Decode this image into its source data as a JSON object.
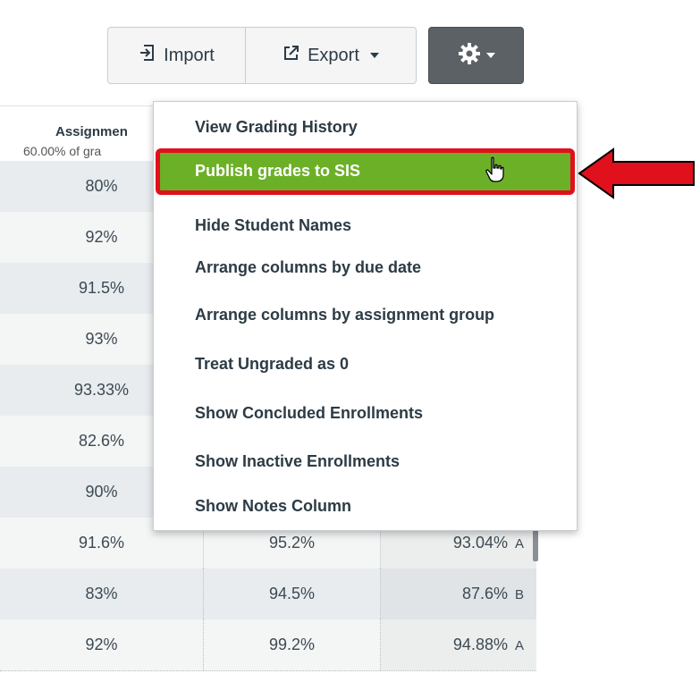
{
  "toolbar": {
    "import_label": "Import",
    "export_label": "Export",
    "icons": {
      "import": "import-icon",
      "export": "export-icon",
      "settings": "gear-icon"
    }
  },
  "grid": {
    "header": {
      "title": "Assignmen",
      "subtitle": "60.00% of gra"
    },
    "rows": [
      {
        "c1": "80%"
      },
      {
        "c1": "92%"
      },
      {
        "c1": "91.5%"
      },
      {
        "c1": "93%"
      },
      {
        "c1": "93.33%"
      },
      {
        "c1": "82.6%"
      },
      {
        "c1": "90%"
      },
      {
        "c1": "91.6%",
        "c2": "95.2%",
        "c3": "93.04%",
        "g": "A"
      },
      {
        "c1": "83%",
        "c2": "94.5%",
        "c3": "87.6%",
        "g": "B"
      },
      {
        "c1": "92%",
        "c2": "99.2%",
        "c3": "94.88%",
        "g": "A"
      }
    ]
  },
  "menu": {
    "items": [
      "View Grading History",
      "Publish grades to SIS",
      "Hide Student Names",
      "Arrange columns by due date",
      "Arrange columns by assignment group",
      "Treat Ungraded as 0",
      "Show Concluded Enrollments",
      "Show Inactive Enrollments",
      "Show Notes Column"
    ],
    "highlight_color": "#6cb027",
    "highlight_border_color": "#e0101c"
  },
  "annotation": {
    "arrow_color": "#e0101c"
  }
}
